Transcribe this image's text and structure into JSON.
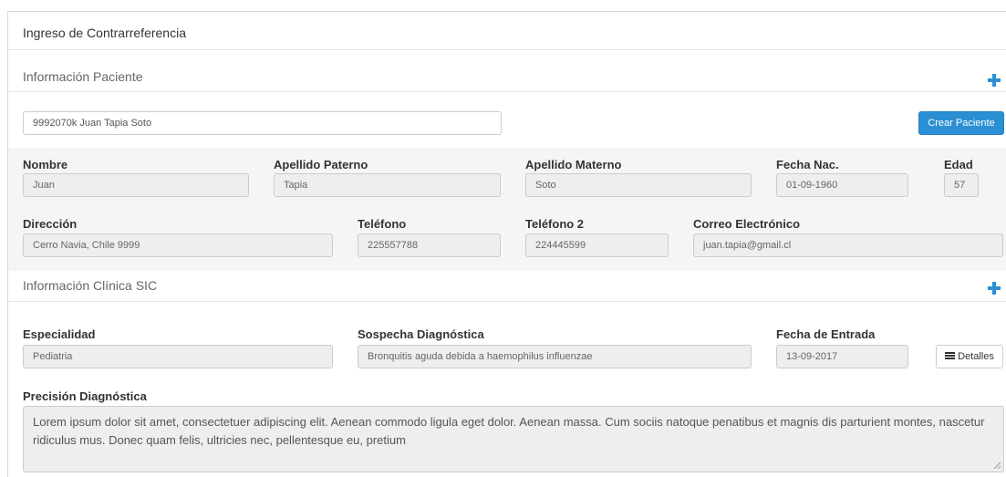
{
  "panel": {
    "title": "Ingreso de Contrarreferencia"
  },
  "patient_section": {
    "title": "Información Paciente",
    "search_value": "9992070k Juan Tapia Soto",
    "create_button": "Crear Paciente",
    "fields": {
      "nombre": {
        "label": "Nombre",
        "value": "Juan"
      },
      "apellido_paterno": {
        "label": "Apellido Paterno",
        "value": "Tapia"
      },
      "apellido_materno": {
        "label": "Apellido Materno",
        "value": "Soto"
      },
      "fecha_nac": {
        "label": "Fecha Nac.",
        "value": "01-09-1960"
      },
      "edad": {
        "label": "Edad",
        "value": "57"
      },
      "direccion": {
        "label": "Dirección",
        "value": "Cerro Navia, Chile 9999"
      },
      "telefono": {
        "label": "Teléfono",
        "value": "225557788"
      },
      "telefono2": {
        "label": "Teléfono 2",
        "value": "224445599"
      },
      "correo": {
        "label": "Correo Electrónico",
        "value": "juan.tapia@gmail.cl"
      }
    }
  },
  "clinical_section": {
    "title": "Información Clínica SIC",
    "fields": {
      "especialidad": {
        "label": "Especialidad",
        "value": "Pediatria"
      },
      "sospecha": {
        "label": "Sospecha Diagnóstica",
        "value": "Bronquitis aguda debida a haemophilus influenzae"
      },
      "fecha_entrada": {
        "label": "Fecha de Entrada",
        "value": "13-09-2017"
      },
      "precision": {
        "label": "Precisión Diagnóstica",
        "value": "Lorem ipsum dolor sit amet, consectetuer adipiscing elit. Aenean commodo ligula eget dolor. Aenean massa. Cum sociis natoque penatibus et magnis dis parturient montes, nascetur ridiculus mus. Donec quam felis, ultricies nec, pellentesque eu, pretium"
      }
    },
    "details_button": "Detalles"
  },
  "icons": {
    "expand": "plus-icon",
    "details": "list-icon"
  },
  "colors": {
    "accent": "#2b8fd3",
    "field_bg": "#eeeeee",
    "band_bg": "#f5f5f5"
  }
}
